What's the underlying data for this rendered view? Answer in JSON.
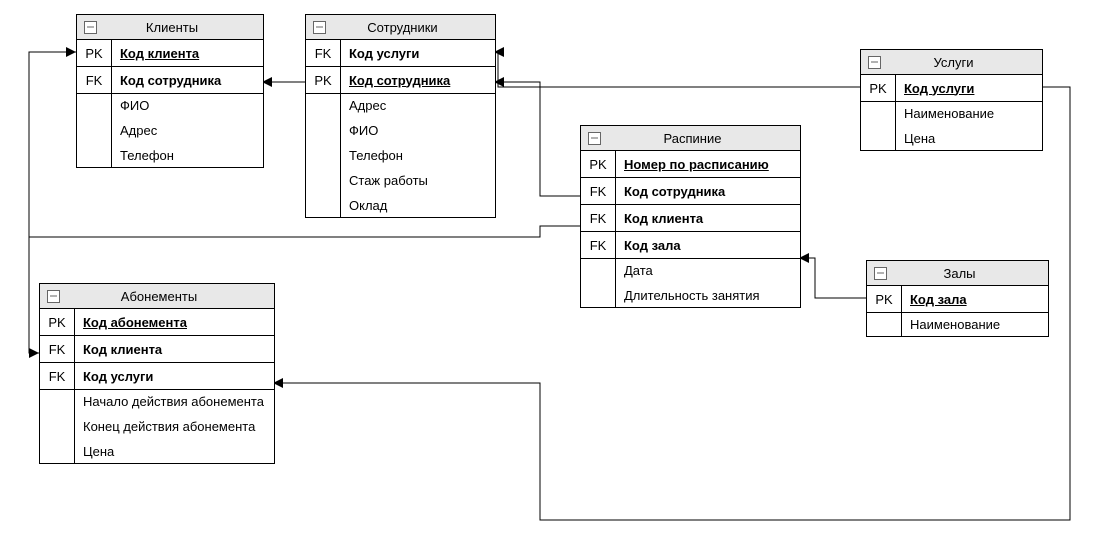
{
  "entities": {
    "clients": {
      "title": "Клиенты",
      "pk": "Код клиента",
      "fk1": "Код сотрудника",
      "attrs": [
        "ФИО",
        "Адрес",
        "Телефон"
      ]
    },
    "employees": {
      "title": "Сотрудники",
      "fk1": "Код услуги",
      "pk": "Код сотрудника",
      "attrs": [
        "Адрес",
        "ФИО",
        "Телефон",
        "Стаж работы",
        "Оклад"
      ]
    },
    "services": {
      "title": "Услуги",
      "pk": "Код услуги",
      "attrs": [
        "Наименование",
        "Цена"
      ]
    },
    "schedule": {
      "title": "Распиние",
      "pk": "Номер по расписанию",
      "fk1": "Код сотрудника",
      "fk2": "Код клиента",
      "fk3": "Код зала",
      "attrs": [
        "Дата",
        "Длительность занятия"
      ]
    },
    "halls": {
      "title": "Залы",
      "pk": "Код зала",
      "attrs": [
        "Наименование"
      ]
    },
    "subscriptions": {
      "title": "Абонементы",
      "pk": "Код абонемента",
      "fk1": "Код клиента",
      "fk2": "Код услуги",
      "attrs": [
        "Начало действия абонемента",
        "Конец действия абонемента",
        "Цена"
      ]
    }
  },
  "labels": {
    "pk": "PK",
    "fk": "FK"
  }
}
